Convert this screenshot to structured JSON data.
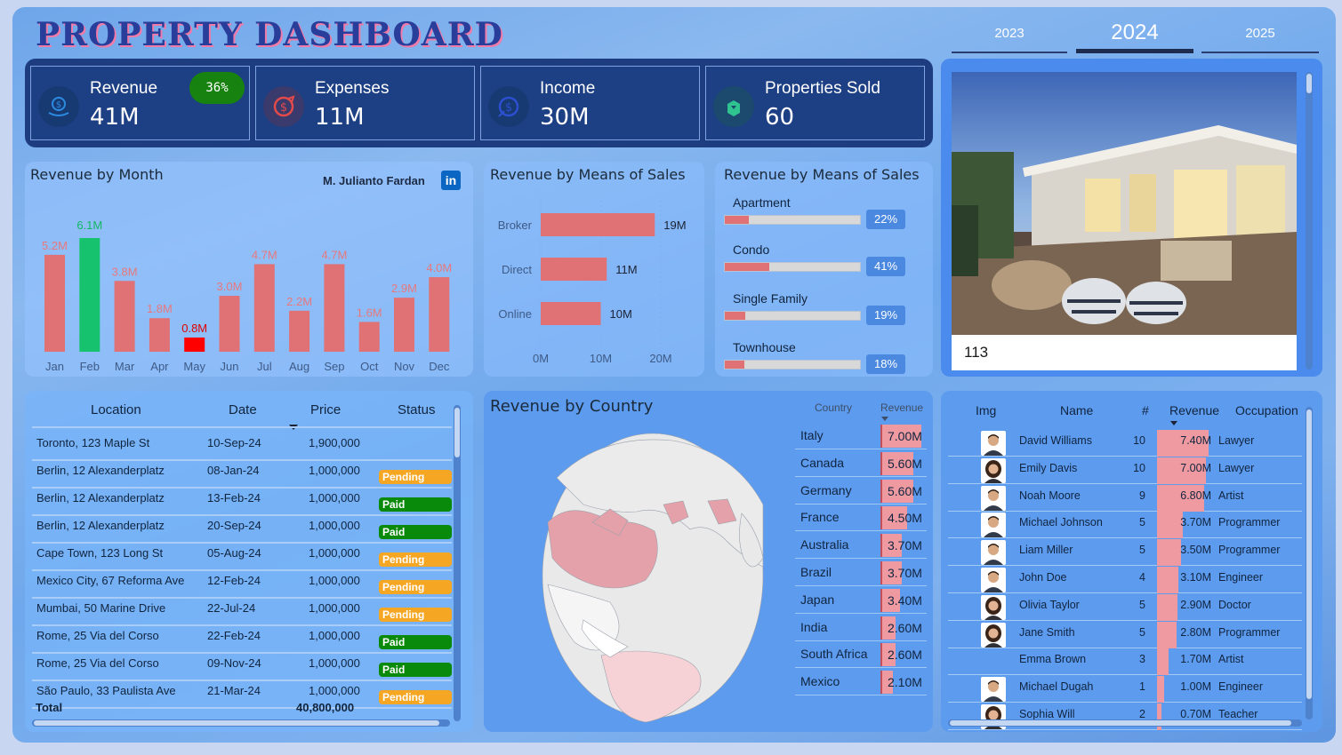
{
  "header": {
    "title": "PROPERTY DASHBOARD",
    "years": [
      "2023",
      "2024",
      "2025"
    ],
    "selected_year": "2024"
  },
  "kpis": [
    {
      "label": "Revenue",
      "value": "41M",
      "icon": "revenue-icon",
      "badge": "36%"
    },
    {
      "label": "Expenses",
      "value": "11M",
      "icon": "expenses-icon"
    },
    {
      "label": "Income",
      "value": "30M",
      "icon": "income-icon"
    },
    {
      "label": "Properties Sold",
      "value": "60",
      "icon": "properties-icon"
    }
  ],
  "revenue_by_month": {
    "title": "Revenue by Month",
    "author": "M. Julianto Fardan"
  },
  "sales_means": {
    "title": "Revenue by Means of Sales"
  },
  "sales_type": {
    "title": "Revenue by Means of Sales",
    "items": [
      {
        "label": "Apartment",
        "value": "22%",
        "fraction": 0.22
      },
      {
        "label": "Condo",
        "value": "41%",
        "fraction": 0.41
      },
      {
        "label": "Single Family",
        "value": "19%",
        "fraction": 0.19
      },
      {
        "label": "Townhouse",
        "value": "18%",
        "fraction": 0.18
      }
    ]
  },
  "property_card": {
    "caption": "113"
  },
  "transactions": {
    "headers": [
      "Location",
      "Date",
      "Price",
      "Status"
    ],
    "rows": [
      {
        "location": "Toronto, 123 Maple St",
        "date": "10-Sep-24",
        "price": "1,900,000",
        "status": ""
      },
      {
        "location": "Berlin, 12 Alexanderplatz",
        "date": "08-Jan-24",
        "price": "1,000,000",
        "status": "Pending"
      },
      {
        "location": "Berlin, 12 Alexanderplatz",
        "date": "13-Feb-24",
        "price": "1,000,000",
        "status": "Paid"
      },
      {
        "location": "Berlin, 12 Alexanderplatz",
        "date": "20-Sep-24",
        "price": "1,000,000",
        "status": "Paid"
      },
      {
        "location": "Cape Town, 123 Long St",
        "date": "05-Aug-24",
        "price": "1,000,000",
        "status": "Pending"
      },
      {
        "location": "Mexico City, 67 Reforma Ave",
        "date": "12-Feb-24",
        "price": "1,000,000",
        "status": "Pending"
      },
      {
        "location": "Mumbai, 50 Marine Drive",
        "date": "22-Jul-24",
        "price": "1,000,000",
        "status": "Pending"
      },
      {
        "location": "Rome, 25 Via del Corso",
        "date": "22-Feb-24",
        "price": "1,000,000",
        "status": "Paid"
      },
      {
        "location": "Rome, 25 Via del Corso",
        "date": "09-Nov-24",
        "price": "1,000,000",
        "status": "Paid"
      },
      {
        "location": "São Paulo, 33 Paulista Ave",
        "date": "21-Mar-24",
        "price": "1,000,000",
        "status": "Pending"
      }
    ],
    "total_label": "Total",
    "total_value": "40,800,000"
  },
  "country": {
    "title": "Revenue by Country",
    "col_country": "Country",
    "col_revenue": "Revenue",
    "rows": [
      {
        "name": "Italy",
        "value": "7.00M",
        "v": 7.0
      },
      {
        "name": "Canada",
        "value": "5.60M",
        "v": 5.6
      },
      {
        "name": "Germany",
        "value": "5.60M",
        "v": 5.6
      },
      {
        "name": "France",
        "value": "4.50M",
        "v": 4.5
      },
      {
        "name": "Australia",
        "value": "3.70M",
        "v": 3.7
      },
      {
        "name": "Brazil",
        "value": "3.70M",
        "v": 3.7
      },
      {
        "name": "Japan",
        "value": "3.40M",
        "v": 3.4
      },
      {
        "name": "India",
        "value": "2.60M",
        "v": 2.6
      },
      {
        "name": "South Africa",
        "value": "2.60M",
        "v": 2.6
      },
      {
        "name": "Mexico",
        "value": "2.10M",
        "v": 2.1
      }
    ]
  },
  "agents": {
    "headers": [
      "Img",
      "Name",
      "#",
      "Revenue",
      "Occupation"
    ],
    "rows": [
      {
        "name": "David Williams",
        "count": "10",
        "revenue": "7.40M",
        "v": 7.4,
        "occupation": "Lawyer",
        "avatar": "male"
      },
      {
        "name": "Emily Davis",
        "count": "10",
        "revenue": "7.00M",
        "v": 7.0,
        "occupation": "Lawyer",
        "avatar": "female"
      },
      {
        "name": "Noah Moore",
        "count": "9",
        "revenue": "6.80M",
        "v": 6.8,
        "occupation": "Artist",
        "avatar": "male"
      },
      {
        "name": "Michael Johnson",
        "count": "5",
        "revenue": "3.70M",
        "v": 3.7,
        "occupation": "Programmer",
        "avatar": "male"
      },
      {
        "name": "Liam Miller",
        "count": "5",
        "revenue": "3.50M",
        "v": 3.5,
        "occupation": "Programmer",
        "avatar": "male"
      },
      {
        "name": "John Doe",
        "count": "4",
        "revenue": "3.10M",
        "v": 3.1,
        "occupation": "Engineer",
        "avatar": "male"
      },
      {
        "name": "Olivia Taylor",
        "count": "5",
        "revenue": "2.90M",
        "v": 2.9,
        "occupation": "Doctor",
        "avatar": "female"
      },
      {
        "name": "Jane Smith",
        "count": "5",
        "revenue": "2.80M",
        "v": 2.8,
        "occupation": "Programmer",
        "avatar": "female"
      },
      {
        "name": "Emma Brown",
        "count": "3",
        "revenue": "1.70M",
        "v": 1.7,
        "occupation": "Artist",
        "avatar": ""
      },
      {
        "name": "Michael Dugah",
        "count": "1",
        "revenue": "1.00M",
        "v": 1.0,
        "occupation": "Engineer",
        "avatar": "male"
      },
      {
        "name": "Sophia Will",
        "count": "2",
        "revenue": "0.70M",
        "v": 0.7,
        "occupation": "Teacher",
        "avatar": "female"
      }
    ]
  },
  "colors": {
    "bar": "#e07174",
    "highlight_max": "#16c26d",
    "highlight_min": "#ff0000",
    "pending": "#f5a623",
    "paid": "#0a8a0a"
  },
  "chart_data": [
    {
      "type": "bar",
      "title": "Revenue by Month",
      "categories": [
        "Jan",
        "Feb",
        "Mar",
        "Apr",
        "May",
        "Jun",
        "Jul",
        "Aug",
        "Sep",
        "Oct",
        "Nov",
        "Dec"
      ],
      "values": [
        5.2,
        6.1,
        3.8,
        1.8,
        0.8,
        3.0,
        4.7,
        2.2,
        4.7,
        1.6,
        2.9,
        4.0
      ],
      "labels": [
        "5.2M",
        "6.1M",
        "3.8M",
        "1.8M",
        "0.8M",
        "3.0M",
        "4.7M",
        "2.2M",
        "4.7M",
        "1.6M",
        "2.9M",
        "4.0M"
      ]
    },
    {
      "type": "bar",
      "orientation": "horizontal",
      "title": "Revenue by Means of Sales",
      "categories": [
        "Broker",
        "Direct",
        "Online"
      ],
      "values": [
        19,
        11,
        10
      ],
      "labels": [
        "19M",
        "11M",
        "10M"
      ],
      "x_ticks": [
        "0M",
        "10M",
        "20M"
      ],
      "xlim": [
        0,
        20
      ]
    }
  ]
}
